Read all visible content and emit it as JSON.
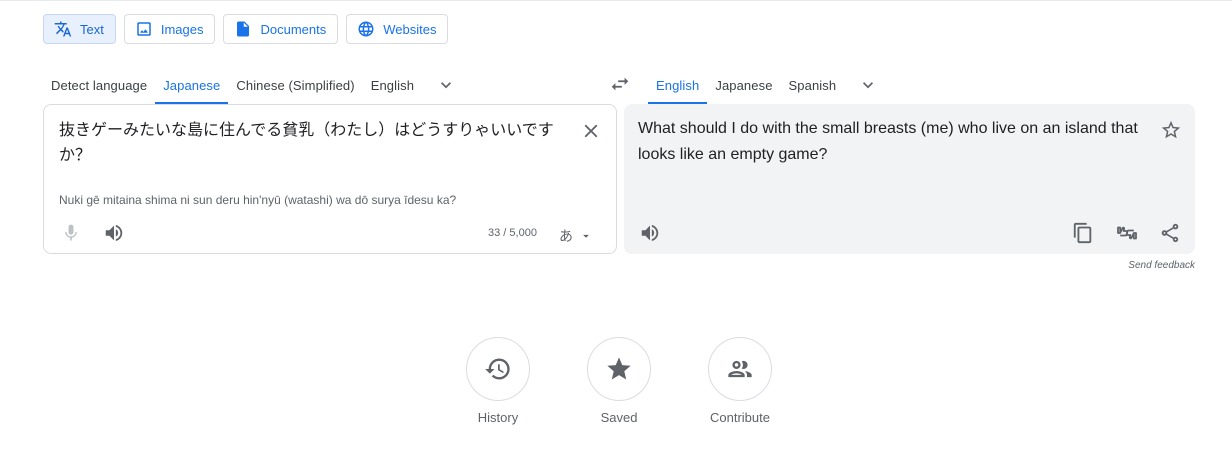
{
  "modes": [
    {
      "label": "Text",
      "icon": "translate-icon",
      "active": true
    },
    {
      "label": "Images",
      "icon": "image-icon",
      "active": false
    },
    {
      "label": "Documents",
      "icon": "document-icon",
      "active": false
    },
    {
      "label": "Websites",
      "icon": "globe-icon",
      "active": false
    }
  ],
  "source_languages": [
    {
      "label": "Detect language",
      "active": false
    },
    {
      "label": "Japanese",
      "active": true
    },
    {
      "label": "Chinese (Simplified)",
      "active": false
    },
    {
      "label": "English",
      "active": false
    }
  ],
  "target_languages": [
    {
      "label": "English",
      "active": true
    },
    {
      "label": "Japanese",
      "active": false
    },
    {
      "label": "Spanish",
      "active": false
    }
  ],
  "source": {
    "text": "抜きゲーみたいな島に住んでる貧乳（わたし）はどうすりゃいいですか？",
    "transliteration": "Nuki gē mitaina shima ni sun deru hin'nyū (watashi) wa dō surya īdesu ka?",
    "char_count": "33 / 5,000",
    "ime_glyph": "あ"
  },
  "target": {
    "text": "What should I do with the small breasts (me) who live on an island that looks like an empty game?"
  },
  "send_feedback": "Send feedback",
  "actions": [
    {
      "label": "History",
      "icon": "history-icon"
    },
    {
      "label": "Saved",
      "icon": "star-icon"
    },
    {
      "label": "Contribute",
      "icon": "people-icon"
    }
  ],
  "colors": {
    "accent": "#1a73e8",
    "active_tab_bg": "#e8f0fe",
    "output_bg": "#f1f3f4",
    "icon_gray": "#5f6368"
  }
}
